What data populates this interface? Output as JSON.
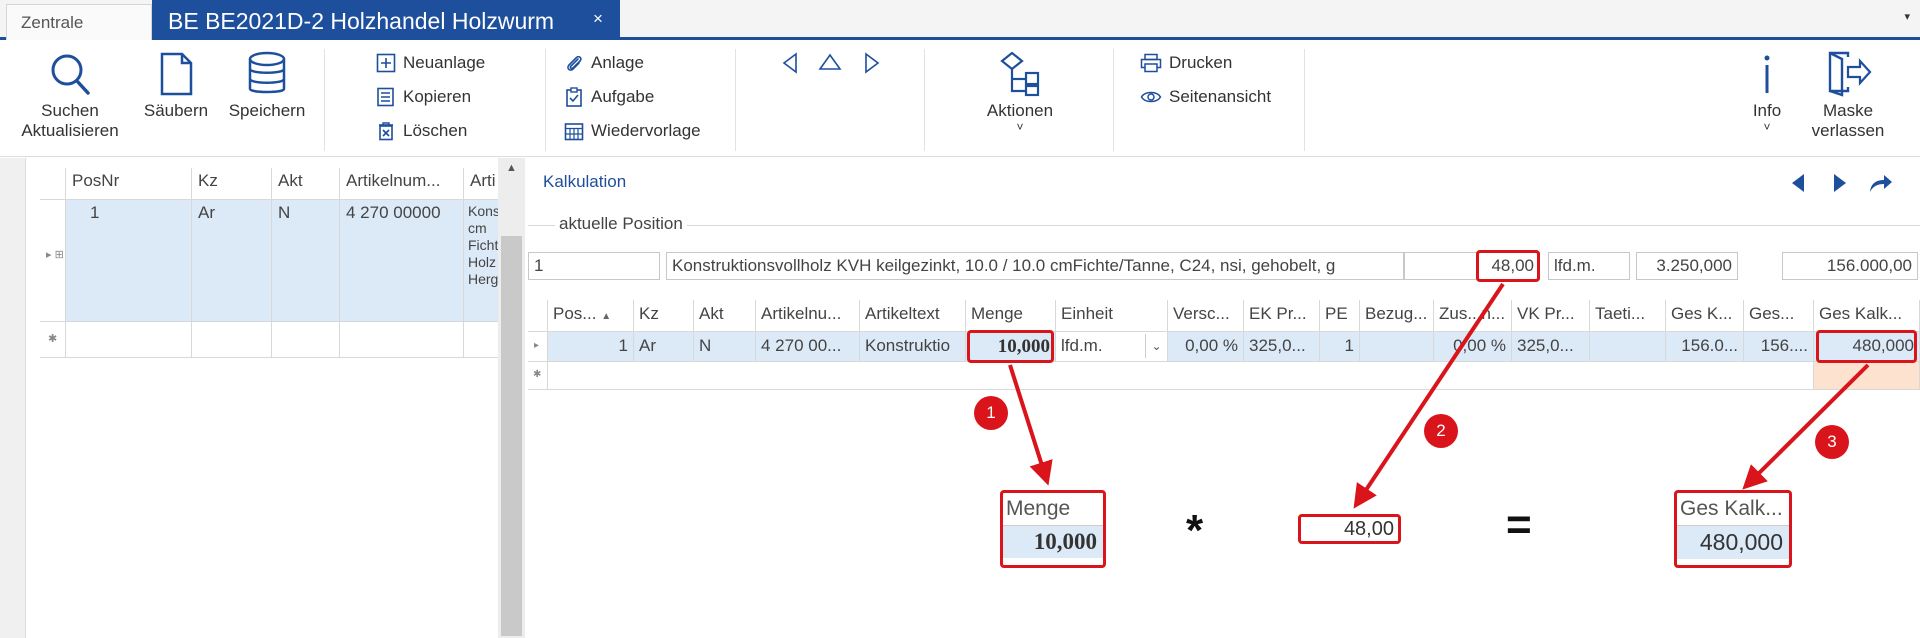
{
  "tabs": {
    "inactive": "Zentrale",
    "active": "BE BE2021D-2 Holzhandel Holzwurm",
    "close": "×",
    "dropdown": "▾"
  },
  "ribbon": {
    "search_line1": "Suchen",
    "search_line2": "Aktualisieren",
    "clear": "Säubern",
    "save": "Speichern",
    "new": "Neuanlage",
    "copy": "Kopieren",
    "delete": "Löschen",
    "attachment": "Anlage",
    "task": "Aufgabe",
    "resubmission": "Wiedervorlage",
    "actions": "Aktionen",
    "actions_caret": "˅",
    "print": "Drucken",
    "page_view": "Seitenansicht",
    "info": "Info",
    "info_caret": "˅",
    "exit_line1": "Maske",
    "exit_line2": "verlassen"
  },
  "left_grid": {
    "headers": [
      "PosNr",
      "Kz",
      "Akt",
      "Artikelnum...",
      "Arti"
    ],
    "row": {
      "posnr": "1",
      "kz": "Ar",
      "akt": "N",
      "artikelnummer": "4 270 00000",
      "artikeltext_lines": [
        "Kons",
        "cm",
        "Ficht",
        "Holz",
        "Herg"
      ]
    }
  },
  "calc": {
    "title": "Kalkulation",
    "section": "aktuelle Position",
    "pos": "1",
    "text": "Konstruktionsvollholz KVH keilgezinkt, 10.0 / 10.0 cmFichte/Tanne, C24, nsi, gehobelt, g",
    "price": "48,00",
    "unit": "lfd.m.",
    "quantity_total": "3.250,000",
    "amount": "156.000,00"
  },
  "right_grid": {
    "headers": [
      "Pos...",
      "Kz",
      "Akt",
      "Artikelnu...",
      "Artikeltext",
      "Menge",
      "Einheit",
      "Versc...",
      "EK Pr...",
      "PE",
      "Bezug...",
      "Zus...n...",
      "VK Pr...",
      "Taeti...",
      "Ges K...",
      "Ges...",
      "Ges Kalk..."
    ],
    "sort_indicator": "▲",
    "row": [
      "1",
      "Ar",
      "N",
      "4 270 00...",
      "Konstruktio",
      "10,000",
      "lfd.m.",
      "0,00 %",
      "325,0...",
      "1",
      "",
      "0,00 %",
      "325,0...",
      "",
      "156.0...",
      "156....",
      "480,000"
    ]
  },
  "annotation": {
    "badges": [
      "1",
      "2",
      "3"
    ],
    "menge_label": "Menge",
    "menge_value": "10,000",
    "multiply": "*",
    "price_value": "48,00",
    "equals": "=",
    "result_label": "Ges Kalk...",
    "result_value": "480,000"
  },
  "colors": {
    "accent": "#1e4f9c",
    "selection": "#dce9f7",
    "highlight": "#d9141b",
    "new_row_cell": "#fde3cf"
  }
}
